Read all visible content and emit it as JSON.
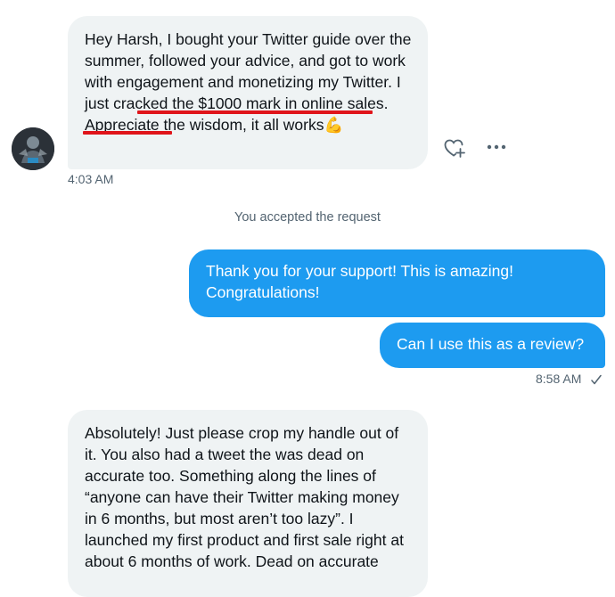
{
  "messages": [
    {
      "direction": "received",
      "text_before": "Hey Harsh, I bought your Twitter guide over the summer, followed your advice, and got to work with engagement and monetizing my Twitter.",
      "highlighted": "I just cracked the $1000 mark in online sales.",
      "text_after": "Appreciate the wisdom, it all works",
      "emoji": "💪",
      "time": "4:03 AM"
    },
    {
      "direction": "sent",
      "text": "Thank you for your support! This is amazing! Congratulations!"
    },
    {
      "direction": "sent",
      "text": "Can I use this as a review?",
      "time": "8:58 AM",
      "status_icon": "checkmark-icon"
    },
    {
      "direction": "received",
      "text": "Absolutely! Just please crop my handle out of it. You also had a tweet the was dead on accurate too. Something along the lines of “anyone can have their Twitter making money in 6 months, but most aren’t too lazy”. I launched my first product and first sale right at about 6 months of work. Dead on accurate"
    }
  ],
  "system_message": "You accepted the request",
  "icons": {
    "react": "heart-plus-icon",
    "more": "more-dots-icon",
    "avatar": "avatar"
  },
  "colors": {
    "sent_bubble": "#1d9bf0",
    "received_bubble": "#eff3f4",
    "highlight_underline": "#e0141a",
    "meta_text": "#536471"
  }
}
